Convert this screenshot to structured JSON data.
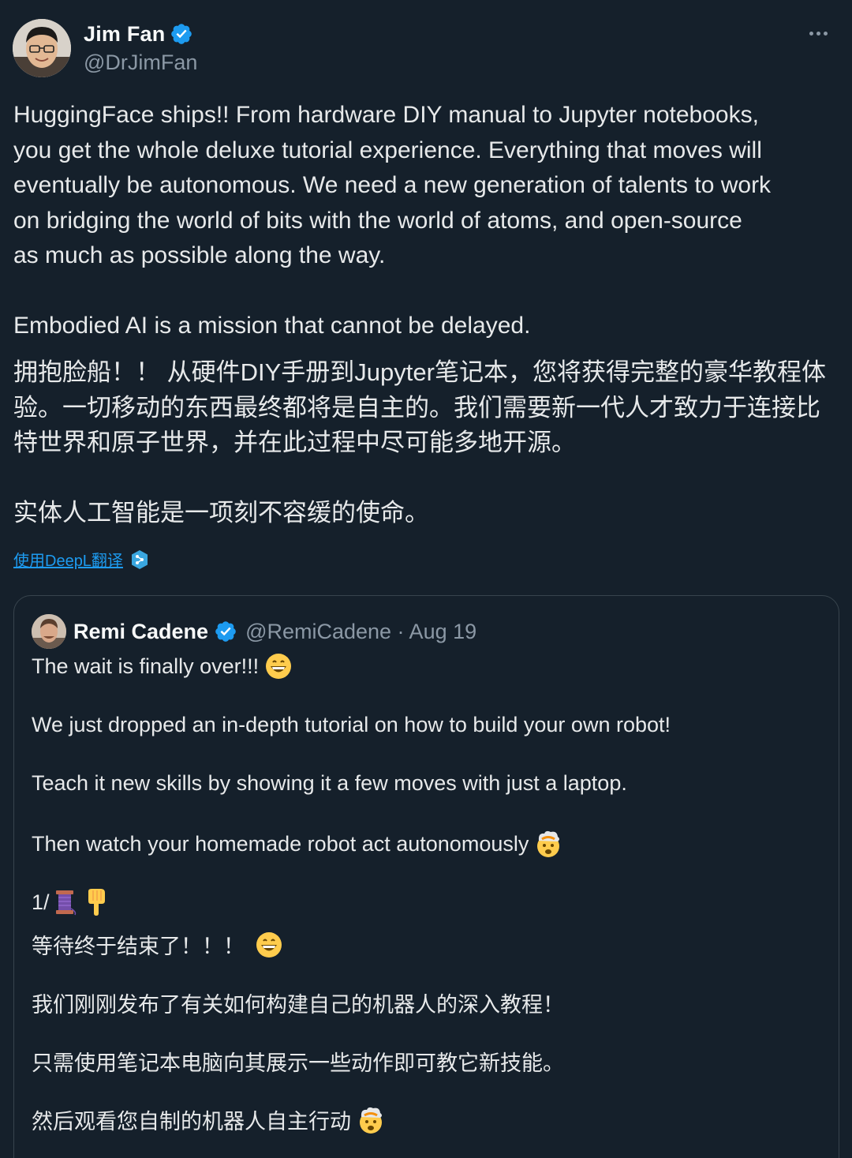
{
  "author": {
    "name": "Jim Fan",
    "handle": "@DrJimFan"
  },
  "post": {
    "text_en": "HuggingFace ships!! From hardware DIY manual to Jupyter notebooks,\nyou get the whole deluxe tutorial experience. Everything that moves will\neventually be autonomous. We need a new generation of talents to work\non bridging the world of bits with the world of atoms, and open-source\nas much as possible along the way.\n\nEmbodied AI is a mission that cannot be delayed.",
    "text_zh": "拥抱脸船！！ 从硬件DIY手册到Jupyter笔记本，您将获得完整的豪华教程体\n验。一切移动的东西最终都将是自主的。我们需要新一代人才致力于连接比\n特世界和原子世界，并在此过程中尽可能多地开源。\n\n实体人工智能是一项刻不容缓的使命。",
    "translate_label": "使用DeepL翻译"
  },
  "quoted": {
    "name": "Remi Cadene",
    "handle_date": "@RemiCadene · Aug 19",
    "lines": [
      "The wait is finally over!!!",
      "We just dropped an in-depth tutorial on how to build your own robot!",
      "Teach it new skills by showing it a few moves with just a laptop.",
      "Then watch your homemade robot act autonomously",
      "1/",
      "等待终于结束了！！！",
      "我们刚刚发布了有关如何构建自己的机器人的深入教程！",
      "只需使用笔记本电脑向其展示一些动作即可教它新技能。",
      "然后观看您自制的机器人自主行动"
    ]
  },
  "icons": {
    "verified": "verified-badge-icon",
    "more": "more-options-icon",
    "deepl": "deepl-icon",
    "grin": "grinning-face-emoji",
    "exploding": "exploding-head-emoji",
    "thread": "thread-spool-emoji",
    "point_down": "pointing-down-emoji"
  },
  "colors": {
    "background": "#15202b",
    "text": "#e7e9ea",
    "secondary": "#8b98a5",
    "accent": "#1d9bf0",
    "border": "#38444d"
  }
}
